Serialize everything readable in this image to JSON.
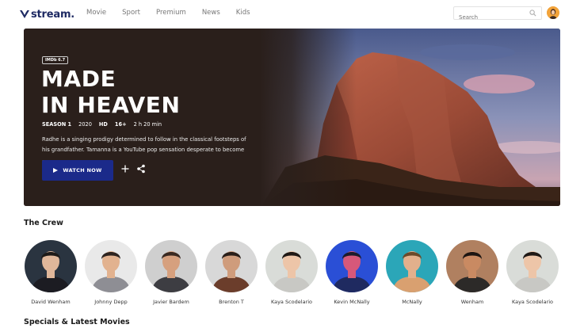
{
  "brand": {
    "name": "stream."
  },
  "nav": {
    "items": [
      "Movie",
      "Sport",
      "Premium",
      "News",
      "Kids"
    ]
  },
  "search": {
    "placeholder": "Search"
  },
  "hero": {
    "rating_badge": "IMDb 6.7",
    "title_line1": "MADE",
    "title_line2": "IN HEAVEN",
    "season": "SEASON 1",
    "year": "2020",
    "quality": "HD",
    "age": "16+",
    "duration": "2 h 20 min",
    "description": "Radhe is a singing prodigy determined to follow in the classical footsteps of his grandfather. Tamanna is a YouTube pop sensation desperate to become .",
    "watch_label": "WATCH NOW"
  },
  "crew": {
    "title": "The Crew",
    "members": [
      {
        "name": "David Wenham",
        "bg": "#2a3440",
        "skin": "#e0b79a",
        "hair": "#1e1a18",
        "shirt": "#1c1c22"
      },
      {
        "name": "Johnny Depp",
        "bg": "#e9e9e9",
        "skin": "#e2b28f",
        "hair": "#2e2420",
        "shirt": "#8e8e94"
      },
      {
        "name": "Javier Bardem",
        "bg": "#cfcfcf",
        "skin": "#d6a07e",
        "hair": "#3a2a22",
        "shirt": "#3d3d42"
      },
      {
        "name": "Brenton T",
        "bg": "#d8d8d8",
        "skin": "#cf9c7c",
        "hair": "#2a1f1a",
        "shirt": "#6b3d2b"
      },
      {
        "name": "Kaya Scodelario",
        "bg": "#d9dcd8",
        "skin": "#edc5a8",
        "hair": "#1f1916",
        "shirt": "#c8c8c4"
      },
      {
        "name": "Kevin McNally",
        "bg": "#2a4fd6",
        "skin": "#d6587a",
        "hair": "#1c1c2c",
        "shirt": "#1f2a60"
      },
      {
        "name": "McNally",
        "bg": "#2ba6b8",
        "skin": "#e2b08c",
        "hair": "#6a4a2a",
        "shirt": "#d9a070"
      },
      {
        "name": "Wenham",
        "bg": "#b08060",
        "skin": "#c98a62",
        "hair": "#1d1512",
        "shirt": "#2c2a28"
      },
      {
        "name": "Kaya Scodelario",
        "bg": "#d9dcd8",
        "skin": "#edc5a8",
        "hair": "#1f1916",
        "shirt": "#c8c8c4"
      }
    ]
  },
  "specials": {
    "title": "Specials & Latest Movies"
  }
}
